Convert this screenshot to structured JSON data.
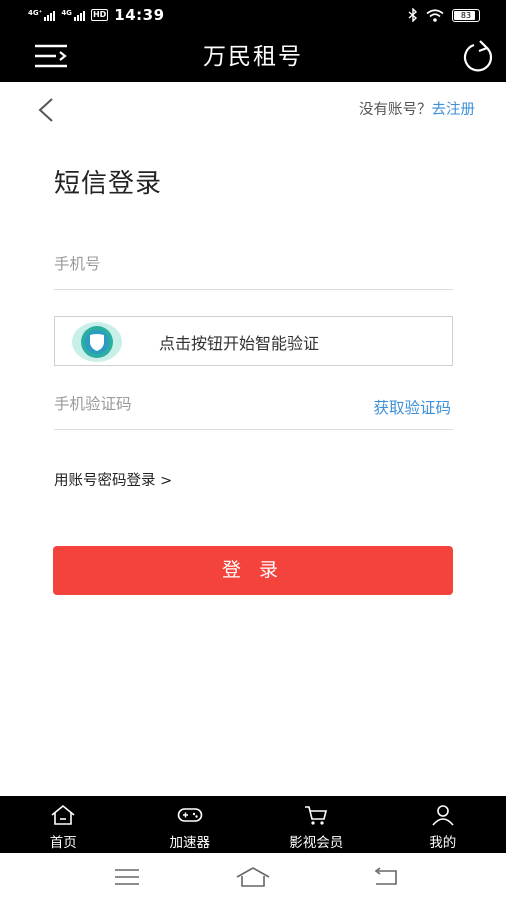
{
  "status_bar": {
    "sim1_label": "4G⁺",
    "sim2_label": "4G",
    "hd_label": "HD",
    "time": "14:39",
    "battery": "83"
  },
  "header": {
    "title": "万民租号",
    "menu_icon": "menu-icon",
    "refresh_icon": "refresh-icon"
  },
  "auth": {
    "no_account_text": "没有账号？",
    "register_link": "去注册"
  },
  "form": {
    "title": "短信登录",
    "phone_placeholder": "手机号",
    "phone_value": "",
    "verify_text": "点击按钮开始智能验证",
    "code_placeholder": "手机验证码",
    "code_value": "",
    "get_code_label": "获取验证码",
    "account_login_label": "用账号密码登录 >",
    "login_button": "登 录"
  },
  "bottom_nav": {
    "items": [
      {
        "label": "首页",
        "icon": "home-icon"
      },
      {
        "label": "加速器",
        "icon": "gamepad-icon"
      },
      {
        "label": "影视会员",
        "icon": "cart-icon"
      },
      {
        "label": "我的",
        "icon": "user-icon"
      }
    ]
  },
  "colors": {
    "accent": "#3d8fd8",
    "login_button": "#f4433c",
    "header_bg": "#000000",
    "verify_icon": "#2aaea0"
  }
}
